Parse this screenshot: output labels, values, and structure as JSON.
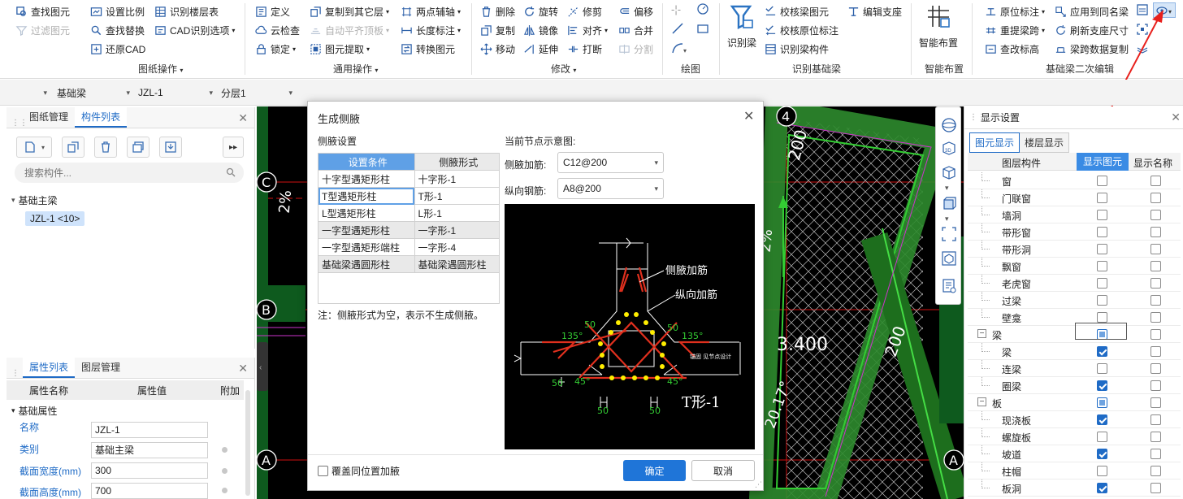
{
  "ribbon": {
    "col1": [
      "查找图元",
      "过滤图元",
      ""
    ],
    "col2": [
      "设置比例",
      "查找替换",
      "还原CAD"
    ],
    "col3": [
      "识别楼层表",
      "CAD识别选项"
    ],
    "col4": [
      "定义",
      "云检查",
      "锁定"
    ],
    "col5": [
      "复制到其它层",
      "自动平齐顶板",
      "图元提取"
    ],
    "col6": [
      "两点辅轴",
      "长度标注",
      "转换图元"
    ],
    "col7": [
      "删除",
      "复制",
      "移动"
    ],
    "col8": [
      "旋转",
      "镜像",
      "延伸"
    ],
    "col9": [
      "修剪",
      "对齐",
      "打断"
    ],
    "col10": [
      "偏移",
      "合并",
      "分割"
    ],
    "big_shibieliang": "识别梁",
    "col11": [
      "校核梁图元",
      "校核原位标注",
      "识别梁构件"
    ],
    "col12": [
      "编辑支座"
    ],
    "big_zhineng": "智能布置",
    "col13": [
      "原位标注",
      "重提梁跨",
      "查改标高"
    ],
    "col14": [
      "应用到同名梁",
      "刷新支座尺寸",
      "梁跨数据复制"
    ],
    "groups": [
      "图纸操作",
      "通用操作",
      "修改",
      "绘图",
      "识别基础梁",
      "智能布置",
      "基础梁二次编辑"
    ]
  },
  "bar2": {
    "c1": "",
    "c2": "基础梁",
    "c3": "JZL-1",
    "c4": "分层1"
  },
  "left_top": {
    "tabs": [
      "图纸管理",
      "构件列表"
    ],
    "search_placeholder": "搜索构件...",
    "tree_parent": "基础主梁",
    "tree_child": "JZL-1 <10>"
  },
  "props": {
    "tabs": [
      "属性列表",
      "图层管理"
    ],
    "headers": [
      "属性名称",
      "属性值",
      "附加"
    ],
    "section": "基础属性",
    "rows": [
      {
        "name": "名称",
        "value": "JZL-1"
      },
      {
        "name": "类别",
        "value": "基础主梁"
      },
      {
        "name": "截面宽度(mm)",
        "value": "300"
      },
      {
        "name": "截面高度(mm)",
        "value": "700"
      }
    ]
  },
  "cad": {
    "labels": {
      "c": "C",
      "b": "B",
      "a": "A",
      "four": "4",
      "dim200a": "200",
      "dim200b": "200",
      "dim3400": "3.400",
      "ang": "2%",
      "ang2": "20.17°",
      "pct": "2%"
    }
  },
  "dialog": {
    "title": "生成侧腋",
    "section": "侧腋设置",
    "headers": [
      "设置条件",
      "侧腋形式"
    ],
    "rows": [
      [
        "十字型遇矩形柱",
        "十字形-1"
      ],
      [
        "T型遇矩形柱",
        "T形-1"
      ],
      [
        "L型遇矩形柱",
        "L形-1"
      ],
      [
        "一字型遇矩形柱",
        "一字形-1"
      ],
      [
        "一字型遇矩形端柱",
        "一字形-4"
      ],
      [
        "基础梁遇圆形柱",
        "基础梁遇圆形柱"
      ]
    ],
    "note": "注：侧腋形式为空，表示不生成侧腋。",
    "preview_label": "当前节点示意图:",
    "field1_label": "侧腋加筋:",
    "field1_value": "C12@200",
    "field2_label": "纵向钢筋:",
    "field2_value": "A8@200",
    "diag": {
      "lbl1": "侧腋加筋",
      "lbl2": "纵向加筋",
      "d50a": "50",
      "d50b": "50",
      "d50c": "50",
      "d50d": "50",
      "d50e": "50",
      "a135a": "135°",
      "a135b": "135°",
      "a45a": "45°",
      "a45b": "45°",
      "shape": "T形-1",
      "note": "锚固 见节点设计"
    },
    "checkbox": "覆盖同位置加腋",
    "ok": "确定",
    "cancel": "取消"
  },
  "right": {
    "title": "显示设置",
    "tabs": [
      "图元显示",
      "楼层显示"
    ],
    "headers": [
      "图层构件",
      "显示图元",
      "显示名称"
    ],
    "rows": [
      {
        "name": "窗",
        "indent": 1,
        "a": false,
        "b": false
      },
      {
        "name": "门联窗",
        "indent": 1,
        "a": false,
        "b": false
      },
      {
        "name": "墙洞",
        "indent": 1,
        "a": false,
        "b": false
      },
      {
        "name": "带形窗",
        "indent": 1,
        "a": false,
        "b": false
      },
      {
        "name": "带形洞",
        "indent": 1,
        "a": false,
        "b": false
      },
      {
        "name": "飘窗",
        "indent": 1,
        "a": false,
        "b": false
      },
      {
        "name": "老虎窗",
        "indent": 1,
        "a": false,
        "b": false
      },
      {
        "name": "过梁",
        "indent": 1,
        "a": false,
        "b": false
      },
      {
        "name": "壁龛",
        "indent": 1,
        "a": false,
        "b": false
      },
      {
        "name": "梁",
        "indent": 0,
        "a": "part",
        "b": false
      },
      {
        "name": "梁",
        "indent": 1,
        "a": true,
        "b": false
      },
      {
        "name": "连梁",
        "indent": 1,
        "a": false,
        "b": false
      },
      {
        "name": "圈梁",
        "indent": 1,
        "a": true,
        "b": false
      },
      {
        "name": "板",
        "indent": 0,
        "a": "part",
        "b": false
      },
      {
        "name": "现浇板",
        "indent": 1,
        "a": true,
        "b": false
      },
      {
        "name": "螺旋板",
        "indent": 1,
        "a": false,
        "b": false
      },
      {
        "name": "坡道",
        "indent": 1,
        "a": true,
        "b": false
      },
      {
        "name": "柱帽",
        "indent": 1,
        "a": false,
        "b": false
      },
      {
        "name": "板洞",
        "indent": 1,
        "a": true,
        "b": false
      }
    ]
  },
  "colors": {
    "accent": "#1f6bc6",
    "cad_bg": "#000000",
    "green": "#33cc33"
  }
}
